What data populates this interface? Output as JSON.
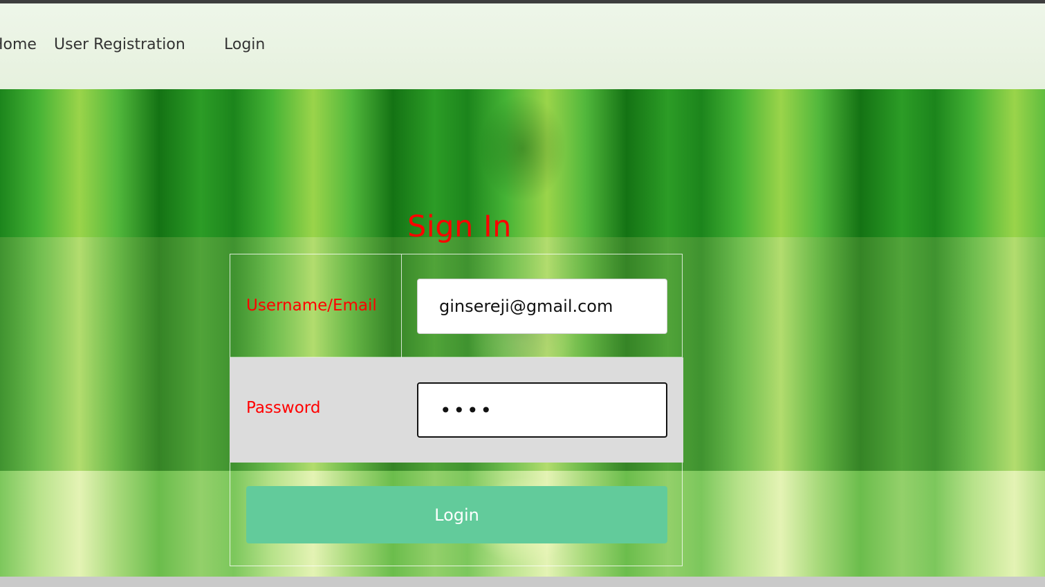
{
  "nav": {
    "home": "Home",
    "user_registration": "User Registration",
    "login": "Login"
  },
  "form": {
    "title": "Sign In",
    "username_label": "Username/Email",
    "username_value": "ginsereji@gmail.com",
    "password_label": "Password",
    "password_masked": "••••",
    "submit_label": "Login"
  },
  "colors": {
    "label_red": "#ff0000",
    "button_green": "#62cb9b",
    "password_row_bg": "#dcdcdc"
  }
}
